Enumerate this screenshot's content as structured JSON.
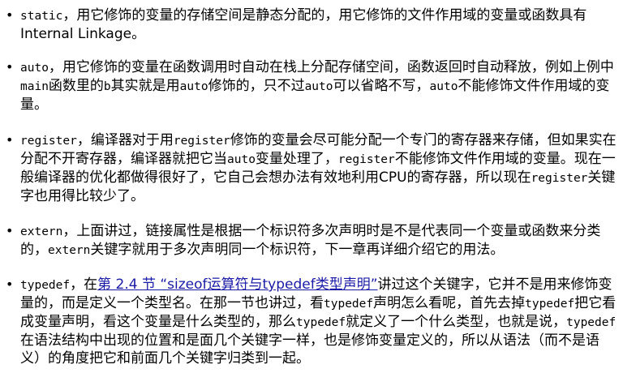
{
  "items": [
    {
      "segments": [
        {
          "t": "static",
          "code": true
        },
        {
          "t": "，用它修饰的变量的存储空间是静态分配的，用它修饰的文件作用域的变量或函数具有Internal Linkage。"
        }
      ]
    },
    {
      "segments": [
        {
          "t": "auto",
          "code": true
        },
        {
          "t": "，用它修饰的变量在函数调用时自动在栈上分配存储空间，函数返回时自动释放，例如上例中"
        },
        {
          "t": "main",
          "code": true
        },
        {
          "t": "函数里的"
        },
        {
          "t": "b",
          "code": true
        },
        {
          "t": "其实就是用"
        },
        {
          "t": "auto",
          "code": true
        },
        {
          "t": "修饰的，只不过"
        },
        {
          "t": "auto",
          "code": true
        },
        {
          "t": "可以省略不写，"
        },
        {
          "t": "auto",
          "code": true
        },
        {
          "t": "不能修饰文件作用域的变量。"
        }
      ]
    },
    {
      "segments": [
        {
          "t": "register",
          "code": true
        },
        {
          "t": "，编译器对于用"
        },
        {
          "t": "register",
          "code": true
        },
        {
          "t": "修饰的变量会尽可能分配一个专门的寄存器来存储，但如果实在分配不开寄存器，编译器就把它当"
        },
        {
          "t": "auto",
          "code": true
        },
        {
          "t": "变量处理了，"
        },
        {
          "t": "register",
          "code": true
        },
        {
          "t": "不能修饰文件作用域的变量。现在一般编译器的优化都做得很好了，它自己会想办法有效地利用CPU的寄存器，所以现在"
        },
        {
          "t": "register",
          "code": true
        },
        {
          "t": "关键字也用得比较少了。"
        }
      ]
    },
    {
      "segments": [
        {
          "t": "extern",
          "code": true
        },
        {
          "t": "，上面讲过，链接属性是根据一个标识符多次声明时是不是代表同一个变量或函数来分类的，"
        },
        {
          "t": "extern",
          "code": true
        },
        {
          "t": "关键字就用于多次声明同一个标识符，下一章再详细介绍它的用法。"
        }
      ]
    },
    {
      "segments": [
        {
          "t": "typedef",
          "code": true
        },
        {
          "t": "，在"
        },
        {
          "t": "第 2.4 节 “sizeof运算符与typedef类型声明”",
          "link": true
        },
        {
          "t": "讲过这个关键字，它并不是用来修饰变量的，而是定义一个类型名。在那一节也讲过，看"
        },
        {
          "t": "typedef",
          "code": true
        },
        {
          "t": "声明怎么看呢，首先去掉"
        },
        {
          "t": "typedef",
          "code": true
        },
        {
          "t": "把它看成变量声明，看这个变量是什么类型的，那么"
        },
        {
          "t": "typedef",
          "code": true
        },
        {
          "t": "就定义了一个什么类型，也就是说，"
        },
        {
          "t": "typedef",
          "code": true
        },
        {
          "t": "在语法结构中出现的位置和是面几个关键字一样，也是修饰变量定义的，所以从语法（而不是语义）的角度把它和前面几个关键字归类到一起。"
        }
      ]
    }
  ]
}
